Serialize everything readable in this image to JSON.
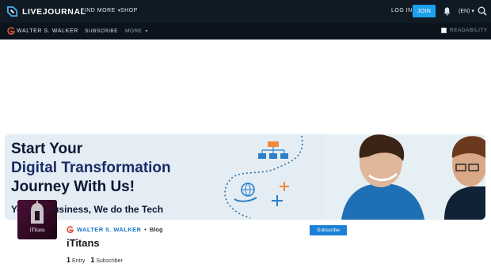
{
  "topbar": {
    "logo_text": "LIVEJOURNAL",
    "find_more": "FIND MORE",
    "shop": "SHOP",
    "login": "LOG IN",
    "join": "JOIN",
    "lang": "(EN)"
  },
  "subbar": {
    "username": "WALTER S. WALKER",
    "subscribe": "SUBSCRIBE",
    "more": "MORE",
    "readability": "READABILITY"
  },
  "banner": {
    "line1": "Start Your",
    "line2": "Digital Transformation",
    "line3": "Journey With Us!",
    "tagline": "You Do Business, We do the Tech"
  },
  "profile": {
    "avatar_text": "iTitans",
    "username": "WALTER S. WALKER",
    "separator": "•",
    "blog_label": "Blog",
    "title": "iTitans",
    "entries_count": "1",
    "entries_label": "Entry",
    "subscribers_count": "1",
    "subscribers_label": "Subscriber",
    "subscribe_button": "Subscribe"
  },
  "colors": {
    "topbar_bg": "#0f1a24",
    "accent": "#1da1ee",
    "link": "#1b74c7"
  }
}
